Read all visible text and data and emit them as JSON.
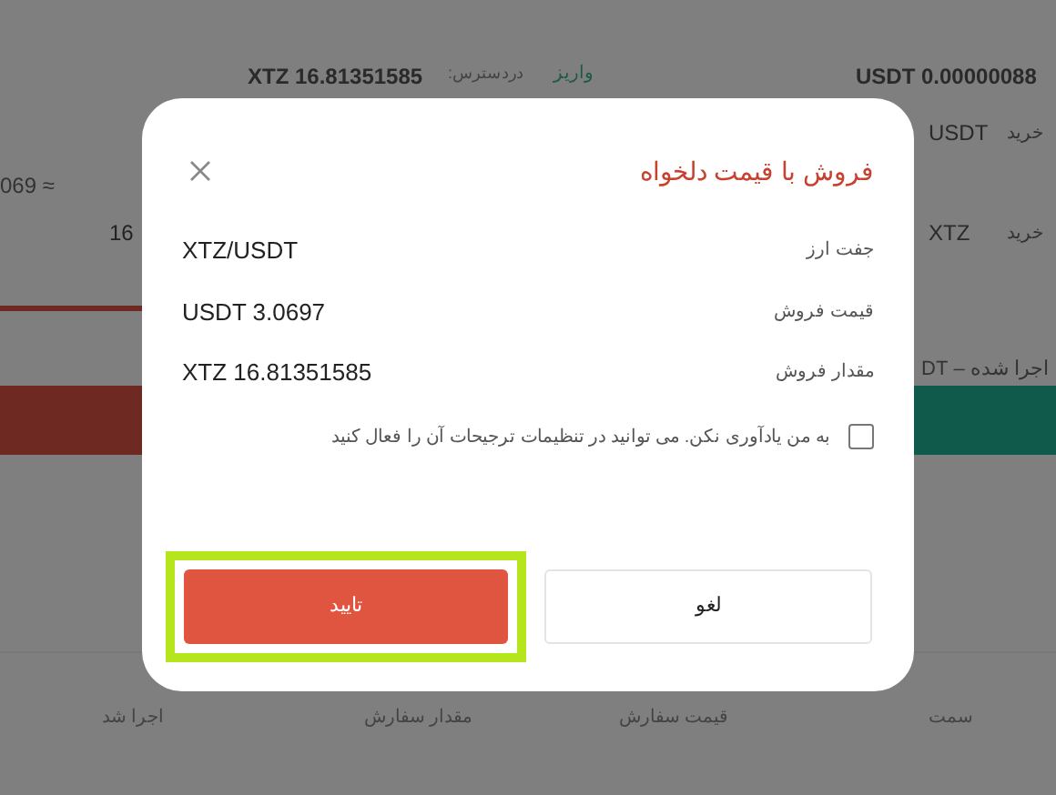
{
  "background": {
    "available_label": "دردسترس:",
    "available_value": "XTZ 16.81351585",
    "deposit_link": "واریز",
    "balance": "USDT 0.00000088",
    "buy_rows": [
      {
        "label": "خرید",
        "unit": "USDT"
      },
      {
        "label": "خرید",
        "unit": "XTZ"
      }
    ],
    "estimate": "069 ≈",
    "amount_partial": "16",
    "filled_note": "اجرا شده – DT",
    "columns": [
      "سمت",
      "قیمت سفارش",
      "مقدار سفارش",
      "اجرا شد"
    ]
  },
  "dialog": {
    "title": "فروش با قیمت دلخواه",
    "rows": [
      {
        "label": "جفت ارز",
        "value": "XTZ/USDT"
      },
      {
        "label": "قیمت فروش",
        "value": "USDT 3.0697"
      },
      {
        "label": "مقدار فروش",
        "value": "XTZ 16.81351585"
      }
    ],
    "reminder": {
      "text": "به من یادآوری نکن. می توانید در تنظیمات ترجیحات آن را فعال کنید",
      "checked": false
    },
    "buttons": [
      {
        "kind": "cancel",
        "label": "لغو"
      },
      {
        "kind": "confirm",
        "label": "تایید",
        "highlighted": true
      }
    ]
  }
}
